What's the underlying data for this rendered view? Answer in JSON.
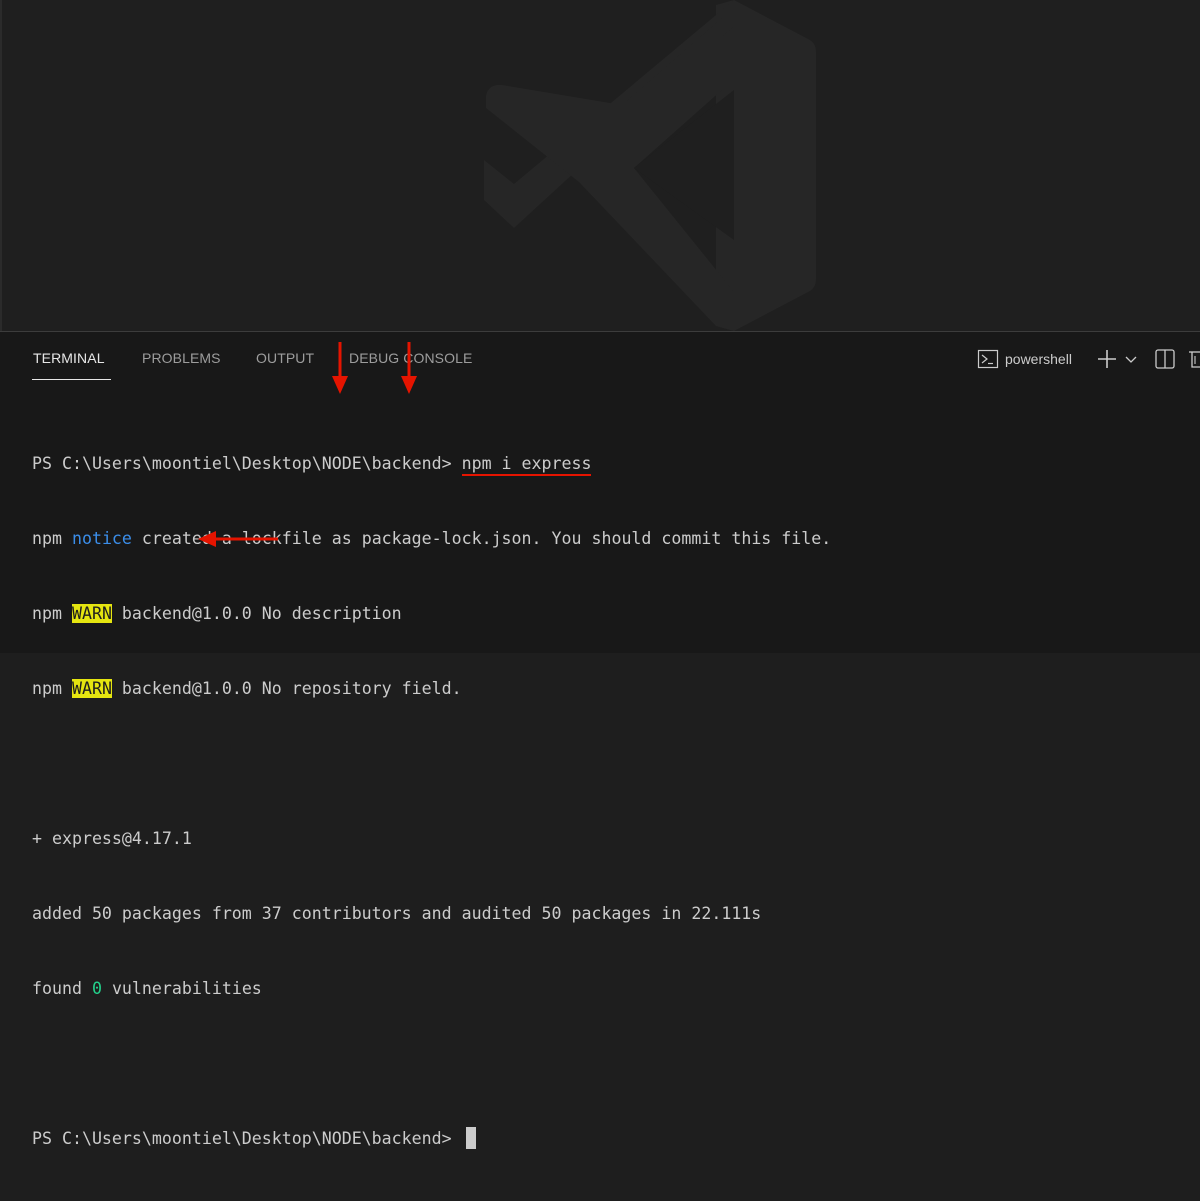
{
  "panel": {
    "tabs": [
      {
        "label": "TERMINAL",
        "active": true
      },
      {
        "label": "PROBLEMS",
        "active": false
      },
      {
        "label": "OUTPUT",
        "active": false
      },
      {
        "label": "DEBUG CONSOLE",
        "active": false
      }
    ],
    "shell_label": "powershell"
  },
  "terminal": {
    "prompt": "PS C:\\Users\\moontiel\\Desktop\\NODE\\backend> ",
    "command": "npm i express",
    "line2_prefix": "npm ",
    "line2_notice": "notice",
    "line2_rest": " created a lockfile as package-lock.json. You should commit this file.",
    "warn_prefix": "npm ",
    "warn_label": "WARN",
    "warn1_rest": " backend@1.0.0 No description",
    "warn2_rest": " backend@1.0.0 No repository field.",
    "installed": "+ express@4.17.1",
    "summary": "added 50 packages from 37 contributors and audited 50 packages in 22.111s",
    "found_prefix": "found ",
    "found_count": "0",
    "found_suffix": " vulnerabilities",
    "prompt2": "PS C:\\Users\\moontiel\\Desktop\\NODE\\backend> "
  },
  "colors": {
    "background": "#1e1e1e",
    "panel": "#181818",
    "notice": "#3b8eea",
    "warn_bg": "#e5e510",
    "success": "#23d18b",
    "annotation": "#e51400"
  }
}
